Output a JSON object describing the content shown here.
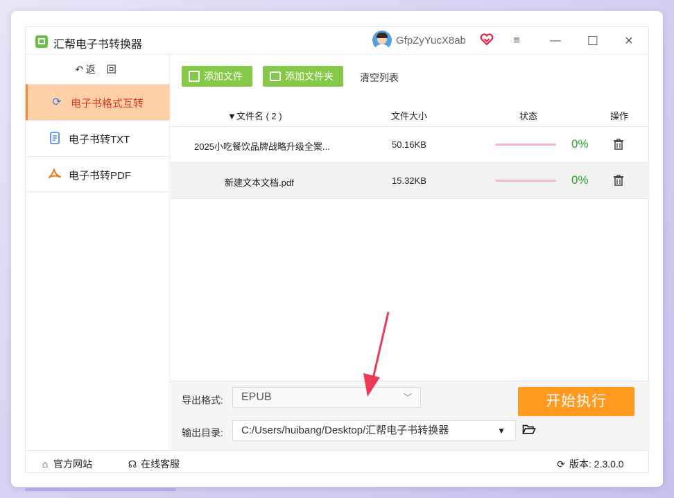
{
  "app": {
    "title": "汇帮电子书转换器",
    "username": "GfpZyYucX8ab",
    "menu_icon": "≡",
    "minimize_icon": "—",
    "maximize_icon": "☐",
    "close_icon": "×"
  },
  "sidebar": {
    "back_label": "返 回",
    "items": [
      {
        "label": "电子书格式互转",
        "icon": "refresh-icon",
        "active": true
      },
      {
        "label": "电子书转TXT",
        "icon": "document-icon",
        "active": false
      },
      {
        "label": "电子书转PDF",
        "icon": "pdf-icon",
        "active": false
      }
    ]
  },
  "toolbar": {
    "add_file_label": "添加文件",
    "add_folder_label": "添加文件夹",
    "clear_label": "清空列表"
  },
  "table": {
    "headers": {
      "name": "▼文件名 ( 2 )",
      "size": "文件大小",
      "status": "状态",
      "action": "操作"
    },
    "rows": [
      {
        "name": "2025小吃餐饮品牌战略升级全案...",
        "size": "50.16KB",
        "progress": "0%"
      },
      {
        "name": "新建文本文档.pdf",
        "size": "15.32KB",
        "progress": "0%"
      }
    ]
  },
  "output": {
    "format_label": "导出格式:",
    "format_value": "EPUB",
    "dir_label": "输出目录:",
    "dir_value": "C:/Users/huibang/Desktop/汇帮电子书转换器",
    "start_label": "开始执行"
  },
  "footer": {
    "website_label": "官方网站",
    "support_label": "在线客服",
    "version_label": "版本:",
    "version_value": "2.3.0.0"
  },
  "colors": {
    "accent_green": "#86c948",
    "accent_orange": "#ff9a1f",
    "active_nav_bg": "#ffd0a8",
    "active_nav_text": "#e2381f",
    "progress_text": "#2ba52b",
    "arrow_red": "#ec3b57"
  }
}
